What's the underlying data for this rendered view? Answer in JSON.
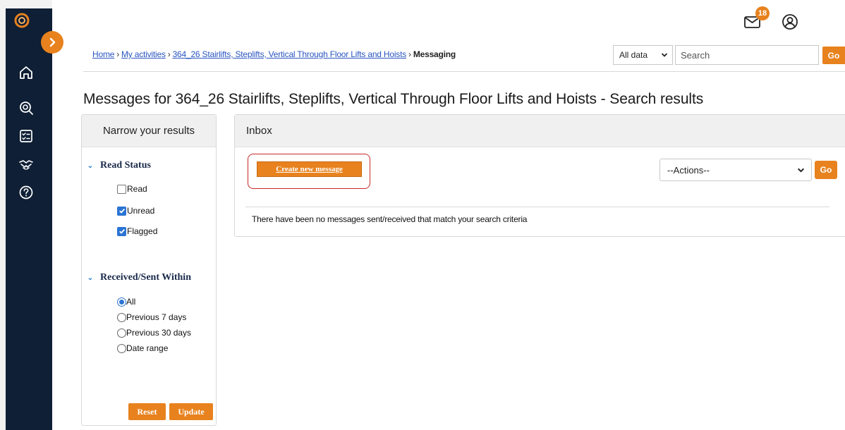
{
  "header": {
    "mail_badge": "18"
  },
  "breadcrumb": {
    "items": [
      "Home",
      "My activities",
      "364_26 Stairlifts, Steplifts, Vertical Through Floor Lifts and Hoists"
    ],
    "separator": "›",
    "current": "Messaging"
  },
  "search": {
    "scope_value": "All data",
    "placeholder": "Search",
    "go_label": "Go"
  },
  "page": {
    "title": "Messages for 364_26 Stairlifts, Steplifts, Vertical Through Floor Lifts and Hoists - Search results"
  },
  "narrow": {
    "title": "Narrow your results",
    "read_status": {
      "heading": "Read Status",
      "options": [
        {
          "label": "Read",
          "checked": false
        },
        {
          "label": "Unread",
          "checked": true
        },
        {
          "label": "Flagged",
          "checked": true
        }
      ]
    },
    "received_within": {
      "heading": "Received/Sent Within",
      "options": [
        {
          "label": "All",
          "selected": true
        },
        {
          "label": "Previous 7 days",
          "selected": false
        },
        {
          "label": "Previous 30 days",
          "selected": false
        },
        {
          "label": "Date range",
          "selected": false
        }
      ]
    },
    "reset_label": "Reset",
    "update_label": "Update"
  },
  "inbox": {
    "title": "Inbox",
    "create_label": "Create new message",
    "actions_value": "--Actions--",
    "actions_go_label": "Go",
    "empty_message": "There have been no messages sent/received that match your search criteria"
  },
  "colors": {
    "accent": "#e8821e",
    "rail": "#0f1f35",
    "link": "#2a55c0",
    "highlight": "#c62828",
    "check": "#2b74d4"
  }
}
